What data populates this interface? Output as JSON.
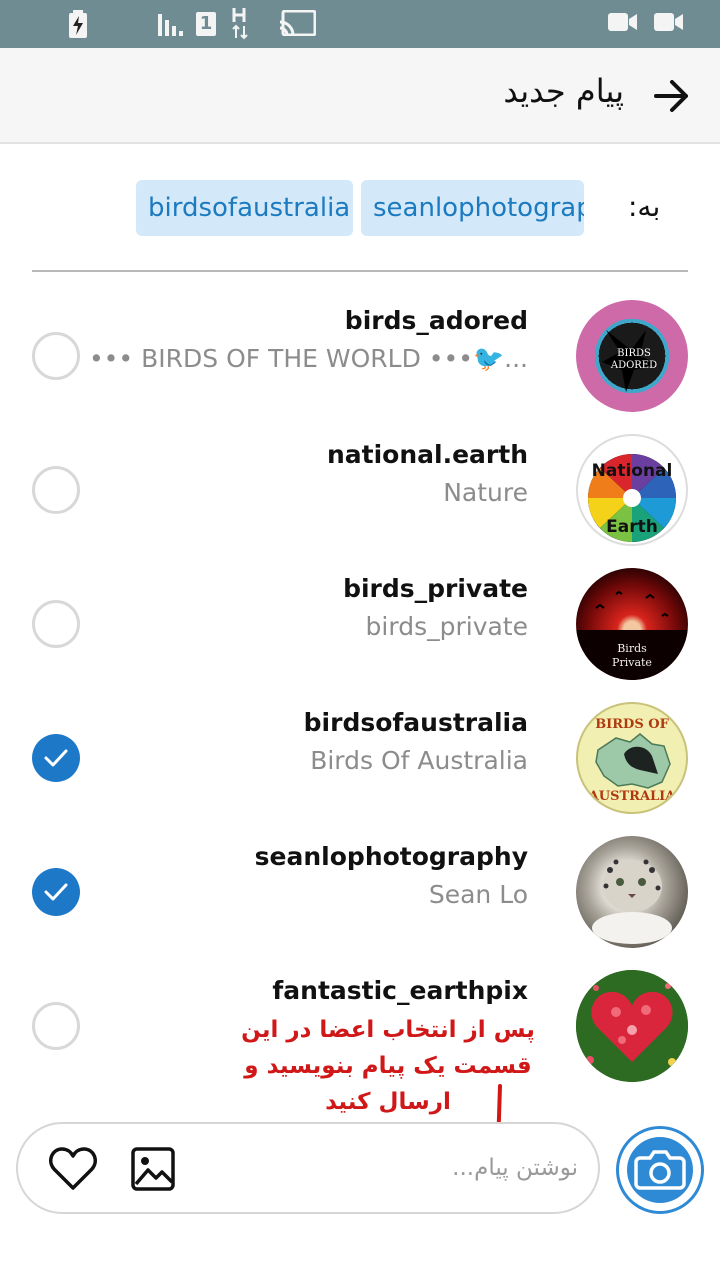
{
  "status_bar": {
    "sim_label": "1",
    "icons": [
      "battery-charging-icon",
      "signal-icon",
      "sim-icon",
      "h-network-icon",
      "cast-icon",
      "video-camera-icon",
      "video-camera-icon"
    ]
  },
  "header": {
    "title": "پیام جدید",
    "back_icon": "arrow-right-icon"
  },
  "recipients": {
    "label": "به:",
    "chips": [
      "birdsofaustralia",
      "seanlophotograp"
    ]
  },
  "contacts": [
    {
      "username": "birds_adored",
      "subtitle": "••• BIRDS OF THE WORLD •••🐦...",
      "selected": false,
      "avatar": "birds-adored-avatar",
      "avatar_text": "BIRDS ADORED"
    },
    {
      "username": "national.earth",
      "subtitle": "Nature",
      "selected": false,
      "avatar": "national-earth-avatar",
      "avatar_text_top": "National",
      "avatar_text_bottom": "Earth"
    },
    {
      "username": "birds_private",
      "subtitle": "birds_private",
      "selected": false,
      "avatar": "birds-private-avatar",
      "avatar_text": "Birds Private"
    },
    {
      "username": "birdsofaustralia",
      "subtitle": "Birds Of Australia",
      "selected": true,
      "avatar": "birds-of-australia-avatar",
      "avatar_text_top": "BIRDS OF",
      "avatar_text_bottom": "AUSTRALIA"
    },
    {
      "username": "seanlophotography",
      "subtitle": "Sean Lo",
      "selected": true,
      "avatar": "snow-leopard-avatar"
    },
    {
      "username": "fantastic_earthpix",
      "subtitle": "",
      "selected": false,
      "avatar": "flower-heart-avatar"
    }
  ],
  "annotation": {
    "line1": "پس از انتخاب اعضا در این",
    "line2": "قسمت یک پیام بنویسید و",
    "line3": "ارسال کنید"
  },
  "composer": {
    "placeholder": "نوشتن پیام...",
    "value": "",
    "icons": [
      "heart-icon",
      "image-icon",
      "camera-icon"
    ]
  },
  "colors": {
    "accent": "#1e78c8",
    "status_bar": "#6f8c93",
    "chip_bg": "#d3e8f8",
    "annotation": "#d01818"
  }
}
